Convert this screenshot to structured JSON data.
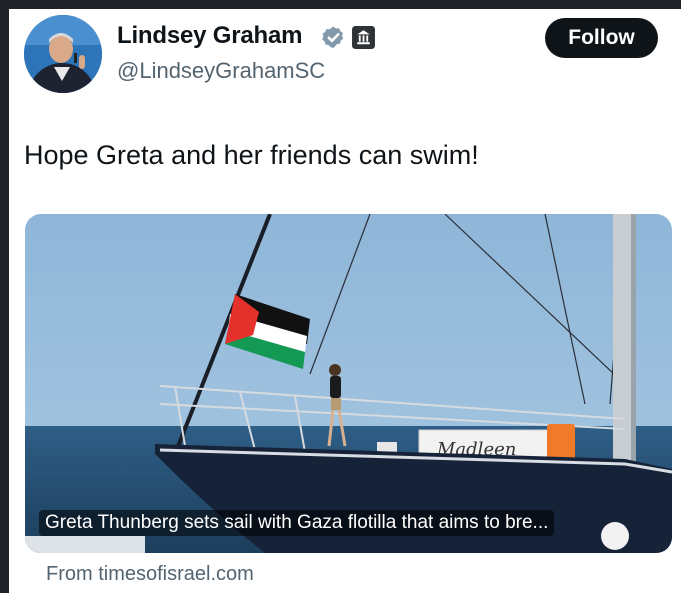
{
  "tweet": {
    "author_name": "Lindsey Graham",
    "handle": "@LindseyGrahamSC",
    "follow_label": "Follow",
    "text": "Hope Greta and her friends can swim!",
    "card": {
      "caption": "Greta Thunberg sets sail with Gaza flotilla that aims to bre...",
      "boat_name": "Madleen",
      "source": "From timesofisrael.com"
    }
  },
  "icons": {
    "verified": "verified-badge-icon",
    "government": "government-building-icon"
  },
  "colors": {
    "text_primary": "#0f1419",
    "text_secondary": "#536471",
    "verified_badge": "#829aab",
    "follow_bg": "#0f1419",
    "follow_text": "#ffffff"
  }
}
